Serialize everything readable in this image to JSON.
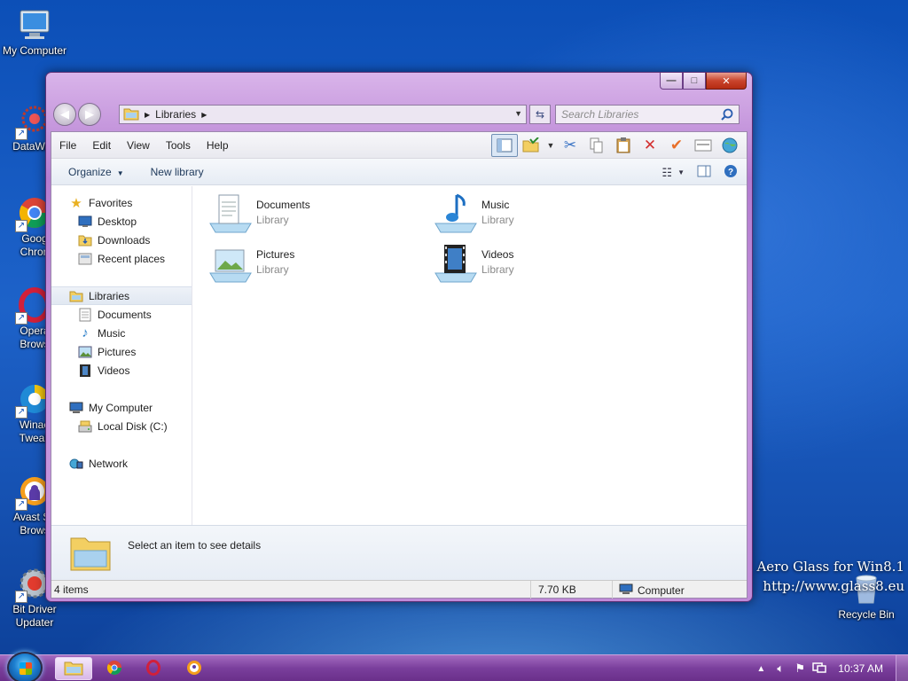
{
  "desktop": {
    "icons": [
      {
        "label": "My Computer"
      },
      {
        "label": "DataWag"
      },
      {
        "label": "Goog"
      },
      {
        "label": "Chron"
      },
      {
        "label": "Opera"
      },
      {
        "label": "Brows"
      },
      {
        "label": "Winae"
      },
      {
        "label": "Tweak"
      },
      {
        "label": "Avast Se"
      },
      {
        "label": "Brows"
      },
      {
        "label": "Bit Driver"
      },
      {
        "label": "Updater"
      }
    ],
    "recycle_bin": "Recycle Bin",
    "watermark_line1": "Aero Glass for Win8.1",
    "watermark_line2": "http://www.glass8.eu"
  },
  "window": {
    "caption": {
      "minimize": "—",
      "maximize": "□",
      "close": "✕"
    },
    "address": {
      "crumb": "Libraries"
    },
    "search": {
      "placeholder": "Search Libraries"
    },
    "menubar": [
      "File",
      "Edit",
      "View",
      "Tools",
      "Help"
    ],
    "commandbar": {
      "organize": "Organize",
      "new_library": "New library"
    },
    "navpane": {
      "favorites": "Favorites",
      "desktop": "Desktop",
      "downloads": "Downloads",
      "recent": "Recent places",
      "libraries": "Libraries",
      "documents": "Documents",
      "music": "Music",
      "pictures": "Pictures",
      "videos": "Videos",
      "my_computer": "My Computer",
      "local_disk": "Local Disk (C:)",
      "network": "Network"
    },
    "libraries": [
      {
        "name": "Documents",
        "type": "Library"
      },
      {
        "name": "Music",
        "type": "Library"
      },
      {
        "name": "Pictures",
        "type": "Library"
      },
      {
        "name": "Videos",
        "type": "Library"
      }
    ],
    "details": {
      "message": "Select an item to see details"
    },
    "status": {
      "items": "4 items",
      "size": "7.70 KB",
      "location": "Computer"
    }
  },
  "taskbar": {
    "clock": "10:37 AM"
  },
  "colors": {
    "window_tint": "#c08bd8",
    "taskbar": "#7a3f9c",
    "desktop": "#1d62c9"
  }
}
